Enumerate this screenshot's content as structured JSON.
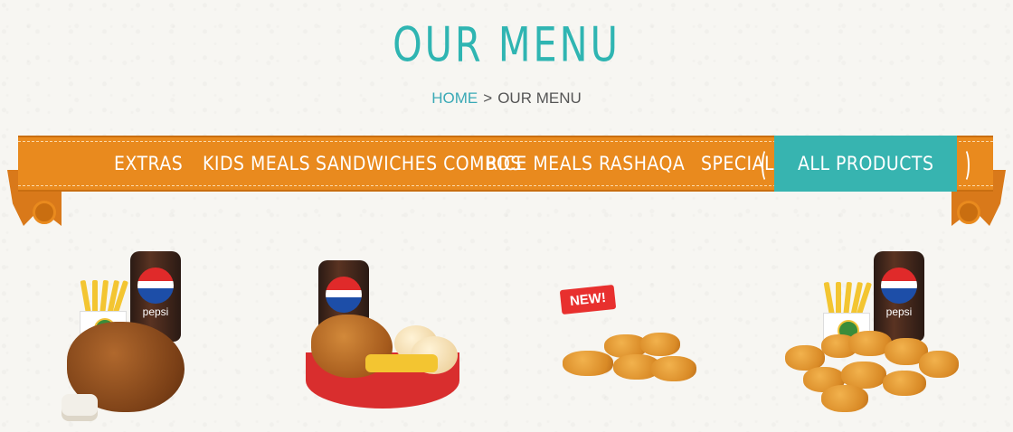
{
  "page": {
    "title": "OUR MENU",
    "breadcrumb": {
      "home": "HOME",
      "separator": ">",
      "current": "OUR MENU"
    }
  },
  "nav": {
    "items": [
      {
        "label": "EXTRAS"
      },
      {
        "label": "KIDS MEALS"
      },
      {
        "label": "SANDWICHES COMBOS"
      },
      {
        "label": "RICE MEALS"
      },
      {
        "label": "RASHAQA"
      },
      {
        "label": "SPECIALS"
      },
      {
        "label": "ALL PRODUCTS",
        "active": true
      }
    ]
  },
  "products": [
    {
      "image": "grilled-chicken-meal",
      "drink_brand": "pepsi"
    },
    {
      "image": "fried-chicken-basket-meal",
      "drink_brand": "pepsi"
    },
    {
      "image": "nuggets",
      "badge": "NEW!"
    },
    {
      "image": "nuggets-meal",
      "drink_brand": "pepsi"
    }
  ],
  "colors": {
    "accent_teal": "#2fb5b2",
    "ribbon_orange": "#e98a1e",
    "new_badge_red": "#e8302e"
  }
}
